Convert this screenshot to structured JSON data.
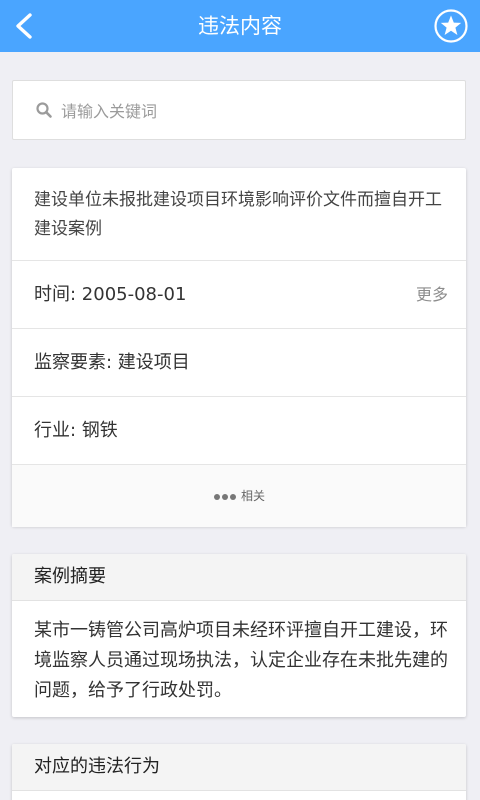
{
  "header": {
    "title": "违法内容",
    "back_icon": "chevron-left-icon",
    "favorite_icon": "star-icon",
    "bar_color": "#4aa5ff"
  },
  "search": {
    "placeholder": "请输入关键词",
    "value": "",
    "icon": "search-icon"
  },
  "case": {
    "title": "建设单位未报批建设项目环境影响评价文件而擅自开工建设案例",
    "time": "时间: 2005-08-01",
    "more_label": "更多",
    "element": "监察要素: 建设项目",
    "industry": "行业: 钢铁",
    "related_label": "相关"
  },
  "summary": {
    "heading": "案例摘要",
    "text": "某市一铸管公司高炉项目未经环评擅自开工建设，环境监察人员通过现场执法，认定企业存在未批先建的问题，给予了行政处罚。"
  },
  "violation": {
    "heading": "对应的违法行为"
  }
}
